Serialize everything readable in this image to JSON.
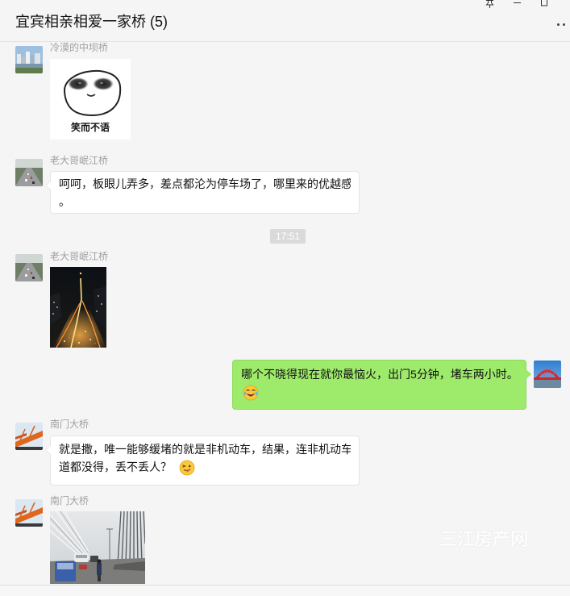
{
  "window": {
    "title": "宜宾相亲相爱一家桥 (5)",
    "controls": [
      "pin-icon",
      "minimize-icon",
      "maximize-icon",
      "more-icon"
    ]
  },
  "colors": {
    "background": "#f5f5f5",
    "outgoing_bubble": "#9eea6a",
    "incoming_bubble": "#ffffff",
    "sender_name": "#a0a0a0",
    "timestamp_pill": "#dadada"
  },
  "messages": [
    {
      "from_me": false,
      "sender": "冷漠的中坝桥",
      "sticker_caption": "笑而不语"
    },
    {
      "from_me": false,
      "sender": "老大哥岷江桥",
      "text_lines": [
        "呵呵，板眼儿弄多，差点都沦为停车场了，哪里来的优越感",
        "。"
      ]
    },
    {
      "time": "17:51"
    },
    {
      "from_me": false,
      "sender": "老大哥岷江桥"
    },
    {
      "from_me": true,
      "text_lines": [
        "哪个不晓得现在就你最恼火，出门5分钟，堵车两小时。"
      ],
      "emoji": "laugh-cry-emoji"
    },
    {
      "from_me": false,
      "sender": "南门大桥",
      "text_lines": [
        "就是撒，唯一能够缓堵的就是非机动车，结果，连非机动车",
        "道都没得，丢不丢人？"
      ],
      "emoji": "tongue-out-emoji"
    },
    {
      "from_me": false,
      "sender": "南门大桥"
    }
  ],
  "watermark": "三江房产网"
}
